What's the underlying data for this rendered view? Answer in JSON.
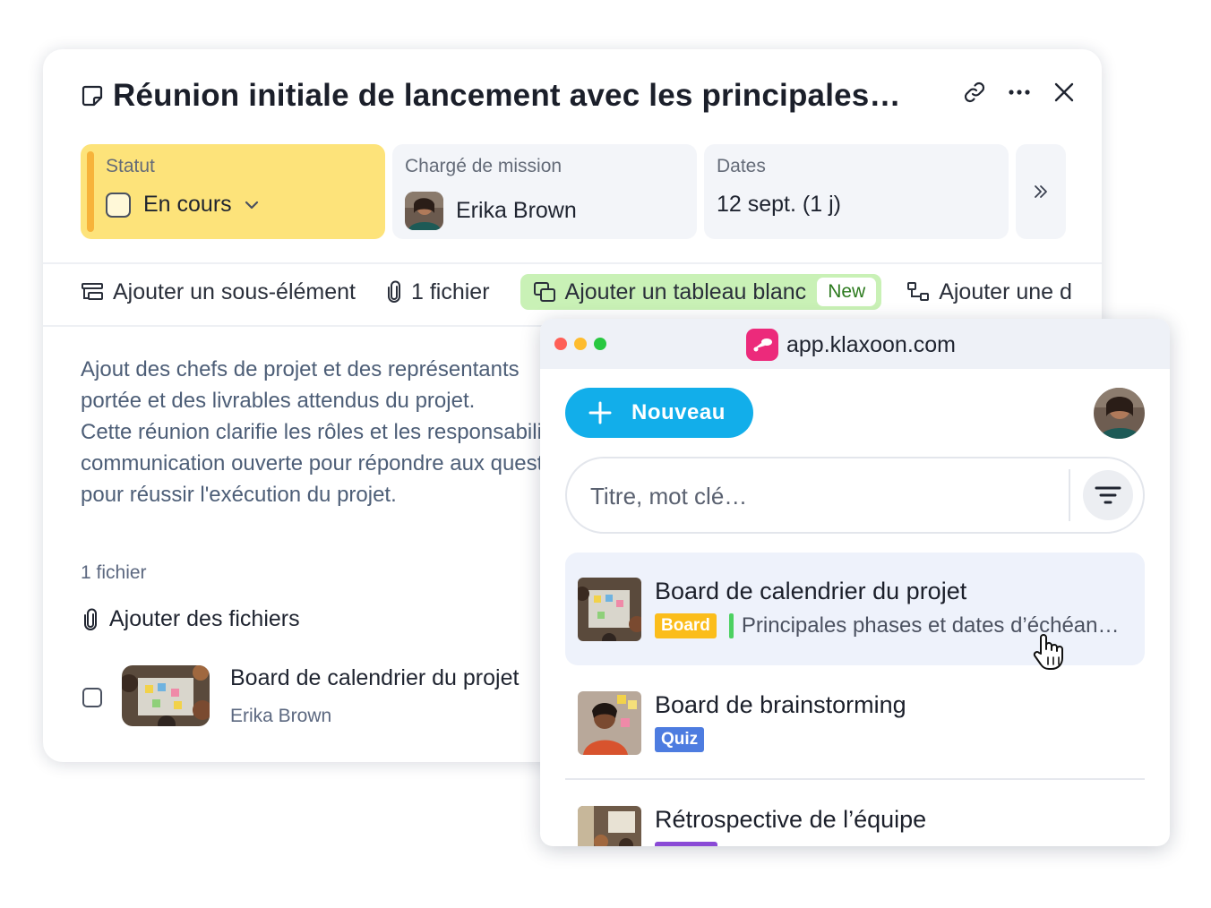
{
  "task": {
    "title": "Réunion initiale de lancement avec les principales…",
    "status": {
      "label": "Statut",
      "value": "En cours"
    },
    "owner": {
      "label": "Chargé de mission",
      "name": "Erika Brown"
    },
    "dates": {
      "label": "Dates",
      "value": "12 sept. (1 j)"
    },
    "actions": {
      "add_subitem": "Ajouter un sous-élément",
      "files": "1 fichier",
      "add_board": "Ajouter un tableau blanc",
      "new_badge": "New",
      "add_dependency": "Ajouter une d"
    },
    "description": [
      "Ajout des chefs de projet et des représentants",
      "portée et des livrables attendus du projet.",
      "Cette réunion clarifie les rôles et les responsabilités",
      "communication ouverte pour répondre aux questions",
      "pour réussir l'exécution du projet."
    ],
    "files_count": "1 fichier",
    "add_files": "Ajouter des fichiers",
    "file": {
      "name": "Board de calendrier du projet",
      "owner": "Erika Brown"
    }
  },
  "popup": {
    "url": "app.klaxoon.com",
    "new_button": "Nouveau",
    "search_placeholder": "Titre, mot clé…",
    "items": [
      {
        "title": "Board de calendrier du projet",
        "tag": "Board",
        "description": "Principales phases et dates d’échéan…"
      },
      {
        "title": "Board de brainstorming",
        "tag": "Quiz"
      },
      {
        "title": "Rétrospective de l’équipe"
      }
    ]
  },
  "colors": {
    "status_bg": "#fde37a",
    "accent_orange": "#f7b33a",
    "board_action_bg": "#c9f1b6",
    "klaxoon_pink": "#ec2a7b",
    "new_button_blue": "#12aeea",
    "tag_board": "#fbbd1b",
    "tag_quiz": "#4d7ce0"
  },
  "icons": [
    "note-icon",
    "link-icon",
    "more-icon",
    "close-icon",
    "chevron-down-icon",
    "double-chevron-right-icon",
    "subitem-icon",
    "paperclip-icon",
    "whiteboard-icon",
    "dependency-icon",
    "plus-icon",
    "filter-icon",
    "hand-cursor-icon"
  ]
}
